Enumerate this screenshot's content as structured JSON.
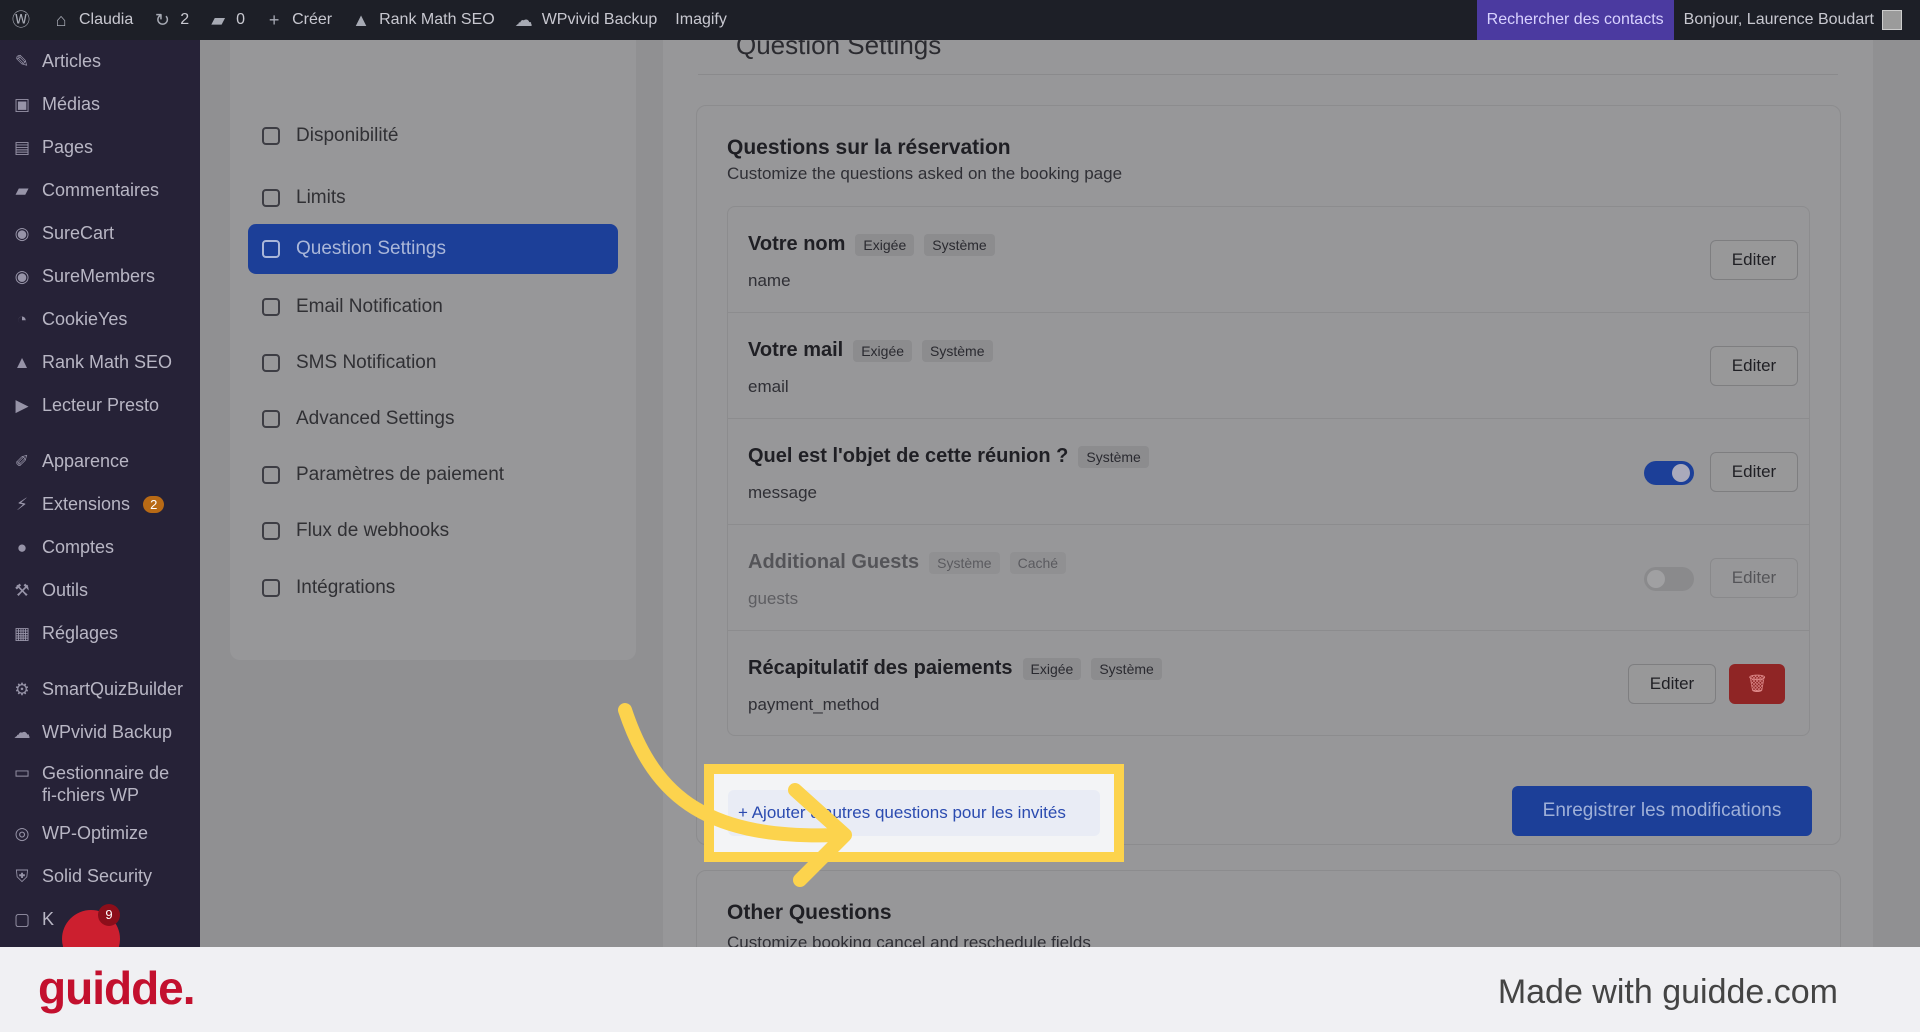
{
  "adminbar": {
    "site": "Claudia",
    "updates": "2",
    "comments": "0",
    "create": "Créer",
    "rankmath": "Rank Math SEO",
    "wpvivid": "WPvivid Backup",
    "imagify": "Imagify",
    "search_contacts": "Rechercher des contacts",
    "greeting": "Bonjour, Laurence Boudart"
  },
  "sidebar": {
    "items": [
      {
        "label": "Articles",
        "icon": "pin-icon"
      },
      {
        "label": "Médias",
        "icon": "media-icon"
      },
      {
        "label": "Pages",
        "icon": "page-icon"
      },
      {
        "label": "Commentaires",
        "icon": "comment-icon"
      },
      {
        "label": "SureCart",
        "icon": "surecart-icon"
      },
      {
        "label": "SureMembers",
        "icon": "suremembers-icon"
      },
      {
        "label": "CookieYes",
        "icon": "cookie-icon"
      },
      {
        "label": "Rank Math SEO",
        "icon": "rankmath-icon"
      },
      {
        "label": "Lecteur Presto",
        "icon": "presto-icon"
      },
      {
        "label": "Apparence",
        "icon": "brush-icon"
      },
      {
        "label": "Extensions",
        "icon": "plugin-icon",
        "badge": "2"
      },
      {
        "label": "Comptes",
        "icon": "user-icon"
      },
      {
        "label": "Outils",
        "icon": "wrench-icon"
      },
      {
        "label": "Réglages",
        "icon": "settings-icon"
      },
      {
        "label": "SmartQuizBuilder",
        "icon": "gear-icon"
      },
      {
        "label": "WPvivid Backup",
        "icon": "cloud-icon"
      },
      {
        "label": "Gestionnaire de fi-chiers WP",
        "icon": "folder-icon"
      },
      {
        "label": "WP-Optimize",
        "icon": "optimize-icon"
      },
      {
        "label": "Solid Security",
        "icon": "shield-icon"
      },
      {
        "label": "K",
        "icon": "k-icon"
      }
    ],
    "notif_count": "9"
  },
  "submenu": {
    "items": [
      {
        "label": "Disponibilité",
        "icon": "calendar-icon"
      },
      {
        "label": "Limits",
        "icon": "clock-icon"
      },
      {
        "label": "Question Settings",
        "icon": "question-icon",
        "active": true
      },
      {
        "label": "Email Notification",
        "icon": "mail-icon"
      },
      {
        "label": "SMS Notification",
        "icon": "sms-icon"
      },
      {
        "label": "Advanced Settings",
        "icon": "sliders-icon"
      },
      {
        "label": "Paramètres de paiement",
        "icon": "payment-icon"
      },
      {
        "label": "Flux de webhooks",
        "icon": "link-icon"
      },
      {
        "label": "Intégrations",
        "icon": "integration-icon"
      }
    ]
  },
  "content": {
    "header": "Question Settings",
    "card_title": "Questions sur la réservation",
    "card_subtitle": "Customize the questions asked on the booking page",
    "questions": [
      {
        "title": "Votre nom",
        "tags": [
          "Exigée",
          "Système"
        ],
        "slug": "name",
        "edit": "Editer",
        "toggle": null,
        "dim": false
      },
      {
        "title": "Votre mail",
        "tags": [
          "Exigée",
          "Système"
        ],
        "slug": "email",
        "edit": "Editer",
        "toggle": null,
        "dim": false
      },
      {
        "title": "Quel est l'objet de cette réunion ?",
        "tags": [
          "Système"
        ],
        "slug": "message",
        "edit": "Editer",
        "toggle": "on",
        "dim": false
      },
      {
        "title": "Additional Guests",
        "tags": [
          "Système",
          "Caché"
        ],
        "slug": "guests",
        "edit": "Editer",
        "toggle": "off",
        "dim": true
      },
      {
        "title": "Récapitulatif des paiements",
        "tags": [
          "Exigée",
          "Système"
        ],
        "slug": "payment_method",
        "edit": "Editer",
        "toggle": null,
        "dim": false,
        "delete": true
      }
    ],
    "add_button": "+ Ajouter d'autres questions pour les invités",
    "save_button": "Enregistrer les modifications",
    "other_title": "Other Questions",
    "other_subtitle": "Customize booking cancel and reschedule fields"
  },
  "footer": {
    "brand": "guidde.",
    "made_with": "Made with guidde.com"
  },
  "colors": {
    "highlight": "#fcd34d",
    "primary": "#1c3f98",
    "brand": "#c3102e"
  }
}
